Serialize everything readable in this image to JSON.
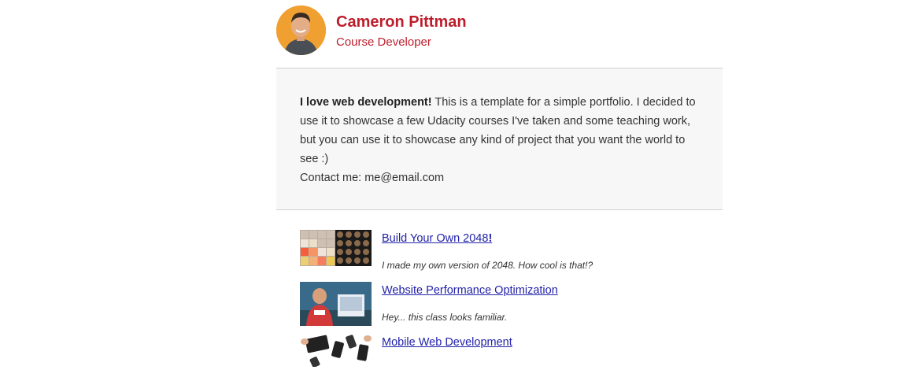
{
  "profile": {
    "name": "Cameron Pittman",
    "role": "Course Developer"
  },
  "intro": {
    "lead": "I love web development!",
    "body": " This is a template for a simple portfolio. I decided to use it to showcase a few Udacity courses I've taken and some teaching work, but you can use it to showcase any kind of project that you want the world to see :)",
    "contact": "Contact me: me@email.com"
  },
  "projects": [
    {
      "title": "Build Your Own 2048",
      "title_suffix": "!",
      "description": "I made my own version of 2048. How cool is that!?",
      "thumb": "2048-game-thumbnail"
    },
    {
      "title": "Website Performance Optimization",
      "description": "Hey... this class looks familiar.",
      "thumb": "presenter-photo-thumbnail"
    },
    {
      "title": "Mobile Web Development",
      "description": "",
      "thumb": "mobile-devices-thumbnail"
    }
  ],
  "colors": {
    "accent": "#bd1e2c",
    "link": "#2222aa",
    "panel": "#f7f7f7"
  }
}
